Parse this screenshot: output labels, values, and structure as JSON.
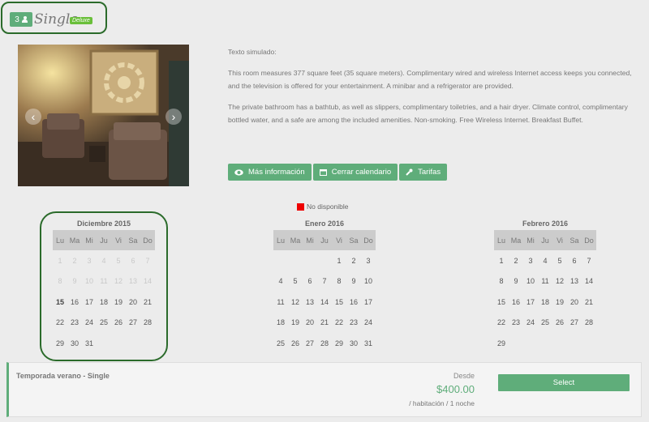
{
  "room": {
    "occupancy": "3",
    "name": "Single",
    "tag": "Deluxe"
  },
  "gallery": {
    "prev_glyph": "‹",
    "next_glyph": "›"
  },
  "description": {
    "p1": "Texto simulado:",
    "p2": "This room measures 377 square feet (35 square meters). Complimentary wired and wireless Internet access keeps you connected, and the television is offered for your entertainment. A minibar and a refrigerator are provided.",
    "p3": "The private bathroom has a bathtub, as well as slippers, complimentary toiletries, and a hair dryer. Climate control, complimentary bottled water, and a safe are among the included amenities. Non-smoking. Free Wireless Internet. Breakfast Buffet."
  },
  "buttons": {
    "more_info": "Más información",
    "close_calendar": "Cerrar calendario",
    "rates": "Tarifas"
  },
  "legend": {
    "unavailable": "No disponible",
    "unavailable_color": "#e00000"
  },
  "weekdays": [
    "Lu",
    "Ma",
    "Mi",
    "Ju",
    "Vi",
    "Sa",
    "Do"
  ],
  "calendars": [
    {
      "title": "Diciembre 2015",
      "offset": 0,
      "days": 31,
      "unavailable_until": 14,
      "today": 15
    },
    {
      "title": "Enero 2016",
      "offset": 4,
      "days": 31,
      "unavailable_until": 0,
      "today": 0
    },
    {
      "title": "Febrero 2016",
      "offset": 0,
      "days": 29,
      "unavailable_until": 0,
      "today": 0
    }
  ],
  "rate": {
    "name": "Temporada verano - Single",
    "from": "Desde",
    "price": "$400.00",
    "unit": "/ habitación / 1 noche",
    "select": "Select"
  },
  "colors": {
    "accent": "#5fad7a",
    "highlight_outline": "#2b6b2b"
  }
}
